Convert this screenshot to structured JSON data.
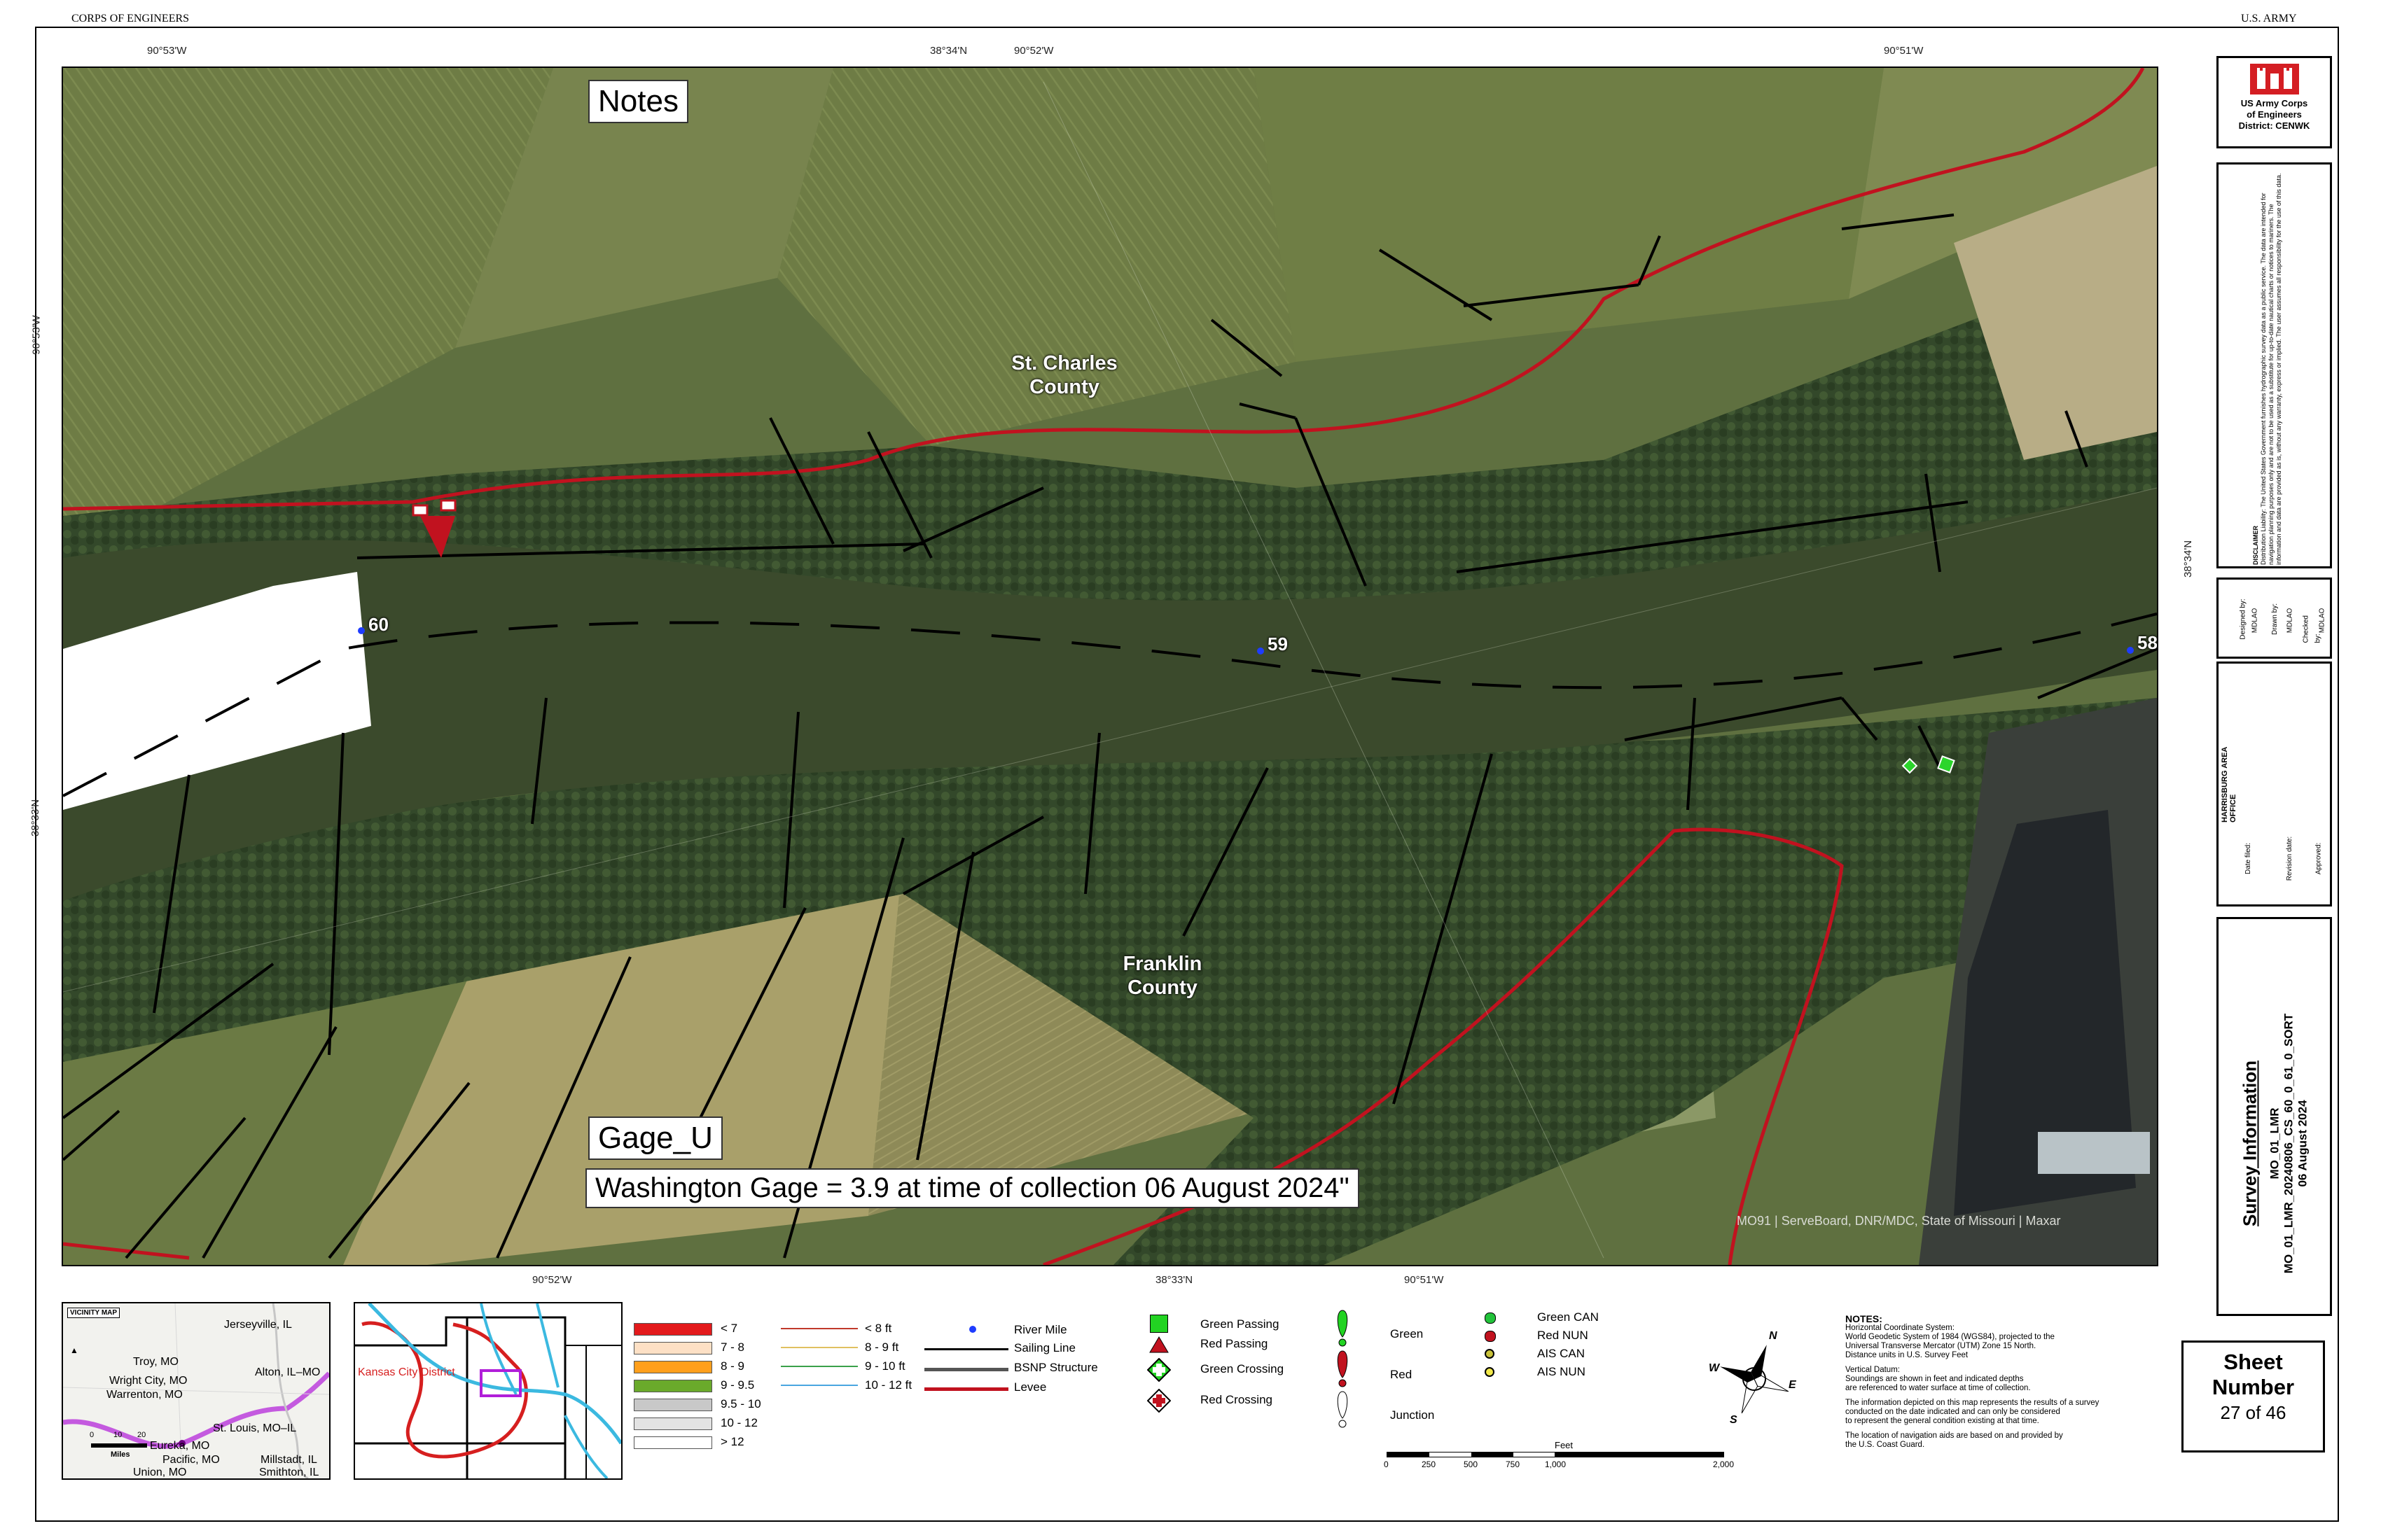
{
  "header": {
    "left": "CORPS OF ENGINEERS",
    "right": "U.S. ARMY"
  },
  "coords": {
    "top": [
      "90°53'W",
      "38°34'N",
      "90°52'W",
      "90°51'W"
    ],
    "bottom": [
      "90°52'W",
      "38°33'N",
      "90°51'W"
    ],
    "left": [
      "90°53'W",
      "38°33'N"
    ],
    "right": [
      "38°34'N"
    ]
  },
  "map": {
    "notes_label": "Notes",
    "gage_label": "Gage_U",
    "gage_text": "Washington Gage = 3.9 at time of collection 06 August 2024\"",
    "counties": {
      "north": [
        "St. Charles",
        "County"
      ],
      "south": [
        "Franklin",
        "County"
      ]
    },
    "river_miles": [
      "60",
      "59",
      "58"
    ],
    "attribution": "MO91 | ServeBoard, DNR/MDC, State of Missouri | Maxar",
    "colors": {
      "levee": "#c1121f",
      "sailing_line": "#000000",
      "river_mile": "#1e3cff",
      "survey": "#ffffff"
    }
  },
  "titleblock": {
    "logo_lines": [
      "US Army Corps",
      "of Engineers",
      "District: CENWK"
    ],
    "disclaimer_title": "DISCLAIMER",
    "disclaimer_text": "Distribution Liability: The United States Government furnishes hydrographic survey data as a public service. The data are intended for navigation planning purposes only and are not to be used as a substitute for up-to-date nautical charts or notices to mariners. The information and data are provided as is, without any warranty, express or implied. The user assumes all responsibility for the use of this data.",
    "sign_fields": [
      "Designed by:",
      "Drawn by:",
      "Checked by:"
    ],
    "sign_values": [
      "MDLAO",
      "MDLAO",
      "MDLAO"
    ],
    "office": "HARRISBURG AREA OFFICE",
    "approval_rows": [
      "Date filed:",
      "Revision date:",
      "Approved:"
    ],
    "survey_info": {
      "heading": "Survey Information",
      "line1": "MO_01_LMR_20240806_CS_60_0_61_0_SORT",
      "line2": "MO_01_LMR",
      "line3": "06 August 2024"
    },
    "sheet": {
      "label1": "Sheet",
      "label2": "Number",
      "value": "27 of 46"
    }
  },
  "vicinity": {
    "title": "VICINITY MAP",
    "places": [
      "Jerseyville, IL",
      "Troy, MO",
      "Wright City, MO",
      "Alton, IL–MO",
      "Warrenton, MO",
      "St. Louis, MO–IL",
      "Eureka, MO",
      "Pacific, MO",
      "Millstadt, IL",
      "Union, MO",
      "Smithton, IL"
    ],
    "scale_ticks": [
      "0",
      "10",
      "20"
    ],
    "scale_unit": "Miles"
  },
  "district_map": {
    "label": "Kansas City District"
  },
  "depth_legend": {
    "left": [
      {
        "label": "< 7",
        "color": "#e31a1c"
      },
      {
        "label": "7 - 8",
        "color": "#fde0c5"
      },
      {
        "label": "8 - 9",
        "color": "#ff9f1c"
      },
      {
        "label": "9 - 9.5",
        "color": "#6aaa2b"
      },
      {
        "label": "9.5 - 10",
        "color": "#c8c8c8"
      },
      {
        "label": "10 - 12",
        "color": "#e3e3e3"
      },
      {
        "label": "> 12",
        "color": "#ffffff"
      }
    ],
    "right": [
      {
        "label": "< 8 ft",
        "color": "#c0392b"
      },
      {
        "label": "8 - 9 ft",
        "color": "#e0c060"
      },
      {
        "label": "9 - 10 ft",
        "color": "#3aa14a"
      },
      {
        "label": "10 - 12 ft",
        "color": "#4aa6e0"
      }
    ]
  },
  "feature_legend": [
    "River Mile",
    "Sailing Line",
    "BSNP Structure",
    "Levee"
  ],
  "nav_legend": [
    "Green Passing",
    "Red Passing",
    "Green Crossing",
    "Red Crossing"
  ],
  "buoy_legend": {
    "left": [
      "Green",
      "Red",
      "Junction"
    ],
    "right": [
      "Green CAN",
      "Red NUN",
      "AIS CAN",
      "AIS NUN"
    ]
  },
  "scale_bar": {
    "unit": "Feet",
    "ticks": [
      "0",
      "250",
      "500",
      "750",
      "1,000",
      "2,000"
    ]
  },
  "compass": {
    "n": "N",
    "e": "E",
    "s": "S",
    "w": "W"
  },
  "notes": {
    "title": "NOTES:",
    "lines": [
      "Horizontal Coordinate System:",
      "World Geodetic System of 1984 (WGS84), projected to the",
      "Universal Transverse Mercator (UTM) Zone 15 North.",
      "Distance units in U.S. Survey Feet",
      "",
      "Vertical Datum:",
      "Soundings are shown in feet and indicated depths",
      "are referenced to water surface at time of collection.",
      "",
      "The information depicted on this map represents the results of a survey",
      "conducted on the date indicated and can only be considered",
      "to represent the general condition existing at that time.",
      "",
      "The location of navigation aids are based on and provided by",
      "the U.S. Coast Guard."
    ]
  }
}
